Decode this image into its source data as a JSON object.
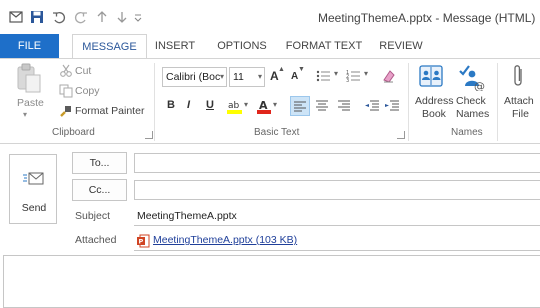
{
  "window": {
    "title": "MeetingThemeA.pptx - Message (HTML)"
  },
  "qat": {
    "icons": [
      "outlook-icon",
      "save-icon",
      "undo-icon",
      "redo-icon",
      "up-arrow-icon",
      "customize-qat-icon"
    ]
  },
  "tabs": [
    {
      "label": "FILE"
    },
    {
      "label": "MESSAGE"
    },
    {
      "label": "INSERT"
    },
    {
      "label": "OPTIONS"
    },
    {
      "label": "FORMAT TEXT"
    },
    {
      "label": "REVIEW"
    }
  ],
  "ribbon": {
    "clipboard": {
      "paste_label": "Paste",
      "cut_label": "Cut",
      "copy_label": "Copy",
      "format_painter_label": "Format Painter",
      "group_label": "Clipboard"
    },
    "basic_text": {
      "font_name": "Calibri (Boc",
      "font_size": "11",
      "group_label": "Basic Text",
      "bold": "B",
      "italic": "I",
      "underline": "U",
      "grow_font": "A",
      "shrink_font": "A"
    },
    "names": {
      "address_book_line1": "Address",
      "address_book_line2": "Book",
      "check_names_line1": "Check",
      "check_names_line2": "Names",
      "group_label": "Names"
    },
    "include": {
      "attach_line1": "Attach",
      "attach_line2": "File"
    }
  },
  "compose": {
    "send_label": "Send",
    "to_label": "To...",
    "cc_label": "Cc...",
    "to_value": "",
    "cc_value": "",
    "subject_label": "Subject",
    "subject_value": "MeetingThemeA.pptx",
    "attached_label": "Attached",
    "attachment": "MeetingThemeA.pptx (103 KB)",
    "body_text": ""
  },
  "colors": {
    "file_tab": "#1e6fc9",
    "accent": "#2b579a",
    "pptx_icon": "#d04423"
  }
}
